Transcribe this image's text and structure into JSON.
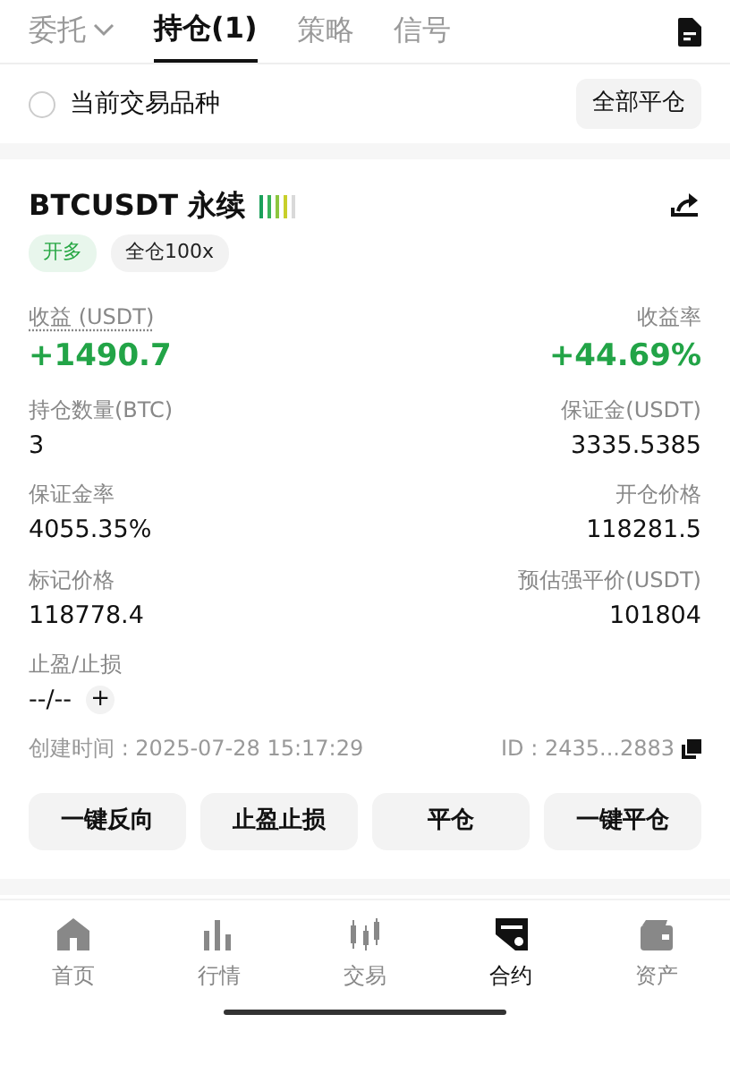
{
  "tabs": [
    {
      "label": "委托",
      "dropdown": true,
      "selected": false
    },
    {
      "label": "持仓(1)",
      "dropdown": false,
      "selected": true
    },
    {
      "label": "策略",
      "dropdown": false,
      "selected": false
    },
    {
      "label": "信号",
      "dropdown": false,
      "selected": false
    }
  ],
  "filter": {
    "label": "当前交易品种",
    "checked": false,
    "button": "全部平仓"
  },
  "position": {
    "symbol": "BTCUSDT 永续",
    "tags": [
      {
        "label": "开多",
        "kind": "side"
      },
      {
        "label": "全仓100x",
        "kind": "margin"
      }
    ],
    "metrics": [
      {
        "label": "收益 (USDT)",
        "value": "+1490.7",
        "underlined": true,
        "positive": true,
        "large": true
      },
      {
        "label": "收益率",
        "value": "+44.69%",
        "underlined": false,
        "positive": true,
        "large": true
      },
      {
        "label": "持仓数量(BTC)",
        "value": "3",
        "underlined": false,
        "positive": false,
        "large": false
      },
      {
        "label": "保证金(USDT)",
        "value": "3335.5385",
        "underlined": false,
        "positive": false,
        "large": false
      },
      {
        "label": "保证金率",
        "value": "4055.35%",
        "underlined": false,
        "positive": false,
        "large": false
      },
      {
        "label": "开仓价格",
        "value": "118281.5",
        "underlined": false,
        "positive": false,
        "large": false
      },
      {
        "label": "标记价格",
        "value": "118778.4",
        "underlined": false,
        "positive": false,
        "large": false
      },
      {
        "label": "预估强平价(USDT)",
        "value": "101804",
        "underlined": false,
        "positive": false,
        "large": false
      }
    ],
    "tp_sl": {
      "label": "止盈/止损",
      "value": "--/--",
      "add": "+"
    },
    "created": "创建时间 : 2025-07-28 15:17:29",
    "id": "ID : 2435...2883",
    "actions": [
      "一键反向",
      "止盈止损",
      "平仓",
      "一键平仓"
    ]
  },
  "bottom_nav": [
    {
      "label": "首页",
      "kind": "home",
      "selected": false
    },
    {
      "label": "行情",
      "kind": "market",
      "selected": false
    },
    {
      "label": "交易",
      "kind": "trade",
      "selected": false
    },
    {
      "label": "合约",
      "kind": "futures",
      "selected": true
    },
    {
      "label": "资产",
      "kind": "assets",
      "selected": false
    }
  ]
}
